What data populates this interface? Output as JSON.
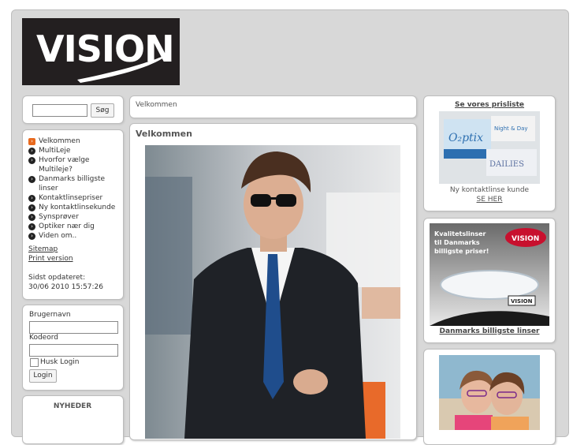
{
  "brand": {
    "logo_text": "VISION"
  },
  "search": {
    "button_label": "Søg",
    "value": ""
  },
  "nav": {
    "items": [
      {
        "label": "Velkommen",
        "active": true
      },
      {
        "label": "MultiLeje",
        "active": false
      },
      {
        "label": "Hvorfor vælge Multileje?",
        "active": false
      },
      {
        "label": "Danmarks billigste linser",
        "active": false
      },
      {
        "label": "Kontaktlinsepriser",
        "active": false
      },
      {
        "label": "Ny kontaktlinsekunde",
        "active": false
      },
      {
        "label": "Synsprøver",
        "active": false
      },
      {
        "label": "Optiker nær dig",
        "active": false
      },
      {
        "label": "Viden om..",
        "active": false
      }
    ],
    "sitemap": "Sitemap",
    "print_version": "Print version",
    "updated_label": "Sidst opdateret:",
    "updated_value": "30/06 2010 15:57:26"
  },
  "login": {
    "username_label": "Brugernavn",
    "password_label": "Kodeord",
    "remember_label": "Husk Login",
    "button_label": "Login"
  },
  "news": {
    "title": "NYHEDER"
  },
  "breadcrumb": {
    "current": "Velkommen"
  },
  "main": {
    "title": "Velkommen"
  },
  "right": {
    "pricelist_title": "Se vores prisliste",
    "new_customer_text": "Ny kontaktlinse kunde",
    "see_here": "SE HER",
    "ad_text_line1": "Kvalitetslinser",
    "ad_text_line2": "til Danmarks",
    "ad_text_line3": "billigste priser!",
    "ad_badge": "VISION",
    "ad_small_badge": "VISION",
    "cheapest_link": "Danmarks billigste linser",
    "product_names": [
      "O₂ptix",
      "DAILIES",
      "Night & Day"
    ]
  },
  "colors": {
    "accent": "#e8691d",
    "logo_bg": "#231f20",
    "page_bg": "#d8d8d8"
  }
}
